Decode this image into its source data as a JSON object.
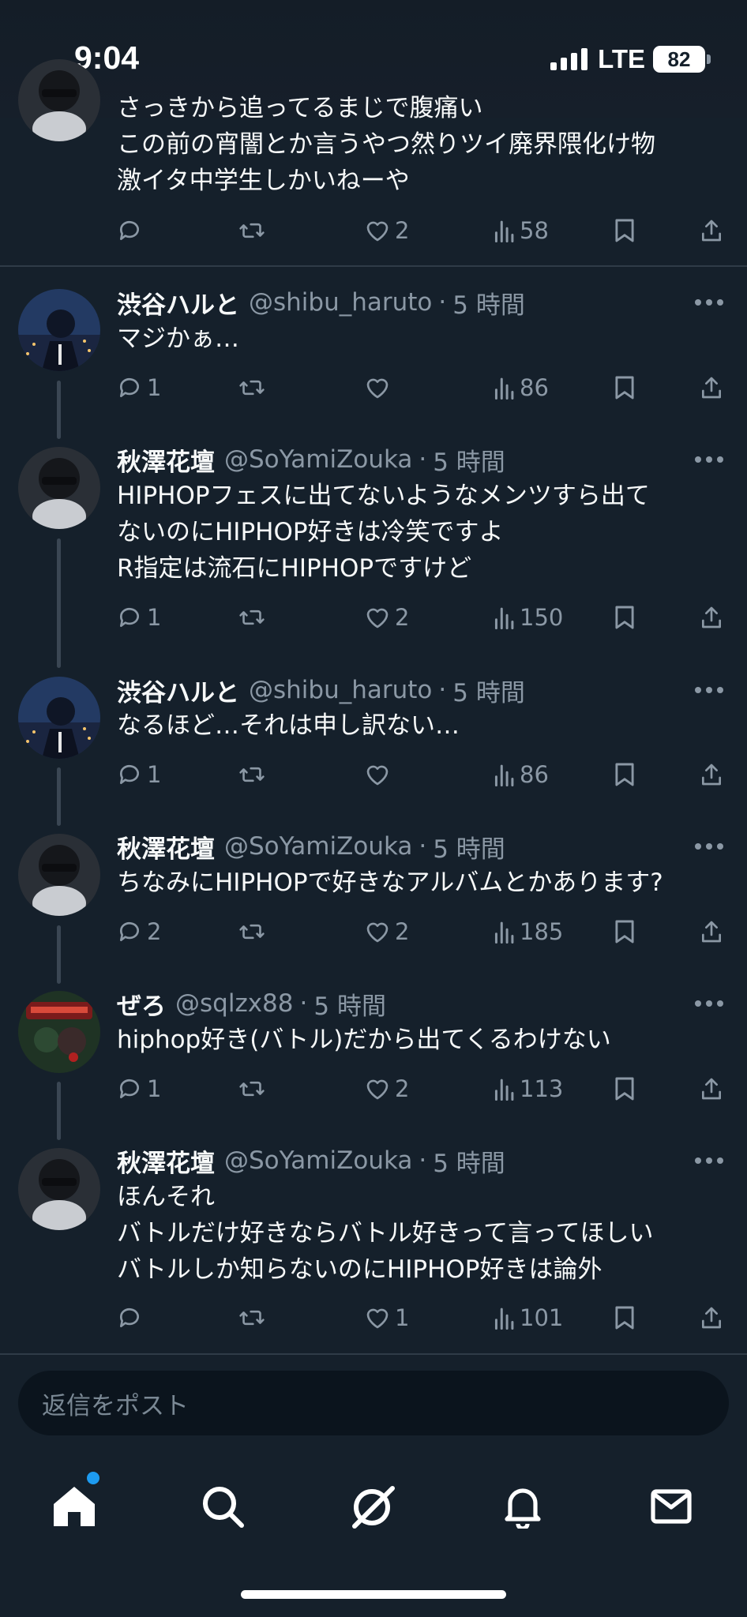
{
  "status_bar": {
    "time": "9:04",
    "network": "LTE",
    "battery": "82"
  },
  "tweets": [
    {
      "name": "",
      "handle": "",
      "time": "",
      "lines": [
        "さっきから追ってるまじで腹痛い",
        "この前の宵闇とか言うやつ然りツイ廃界隈化け物",
        "激イタ中学生しかいねーや"
      ],
      "replies": "",
      "likes": "2",
      "views": "58",
      "liked": false
    },
    {
      "name": "渋谷ハルと",
      "handle": "@shibu_haruto",
      "dot": "·",
      "time": "5 時間",
      "lines": [
        "マジかぁ…"
      ],
      "replies": "1",
      "likes": "",
      "views": "86"
    },
    {
      "name": "秋澤花壇",
      "handle": "@SoYamiZouka",
      "dot": "·",
      "time": "5 時間",
      "lines": [
        "HIPHOPフェスに出てないようなメンツすら出て",
        "ないのにHIPHOP好きは冷笑ですよ",
        "R指定は流石にHIPHOPですけど"
      ],
      "replies": "1",
      "likes": "2",
      "views": "150"
    },
    {
      "name": "渋谷ハルと",
      "handle": "@shibu_haruto",
      "dot": "·",
      "time": "5 時間",
      "lines": [
        "なるほど…それは申し訳ない…"
      ],
      "replies": "1",
      "likes": "",
      "views": "86"
    },
    {
      "name": "秋澤花壇",
      "handle": "@SoYamiZouka",
      "dot": "·",
      "time": "5 時間",
      "lines": [
        "ちなみにHIPHOPで好きなアルバムとかあります?"
      ],
      "replies": "2",
      "likes": "2",
      "views": "185"
    },
    {
      "name": "ぜろ",
      "handle": "@sqlzx88",
      "dot": "·",
      "time": "5 時間",
      "lines": [
        "hiphop好き(バトル)だから出てくるわけない"
      ],
      "replies": "1",
      "likes": "2",
      "views": "113"
    },
    {
      "name": "秋澤花壇",
      "handle": "@SoYamiZouka",
      "dot": "·",
      "time": "5 時間",
      "lines": [
        "ほんそれ",
        "バトルだけ好きならバトル好きって言ってほしい",
        "バトルしか知らないのにHIPHOP好きは論外"
      ],
      "replies": "",
      "likes": "1",
      "views": "101"
    }
  ],
  "composer": {
    "placeholder": "返信をポスト"
  },
  "nav": {
    "items": [
      {
        "icon": "home-icon",
        "active": true,
        "badge": true
      },
      {
        "icon": "search-icon"
      },
      {
        "icon": "grok-icon"
      },
      {
        "icon": "bell-icon"
      },
      {
        "icon": "mail-icon"
      }
    ]
  },
  "colors": {
    "background": "#15202b",
    "text": "#f7f9f9",
    "muted": "#8b98a5",
    "accent": "#1d9bf0",
    "divider": "#2f3b47"
  }
}
